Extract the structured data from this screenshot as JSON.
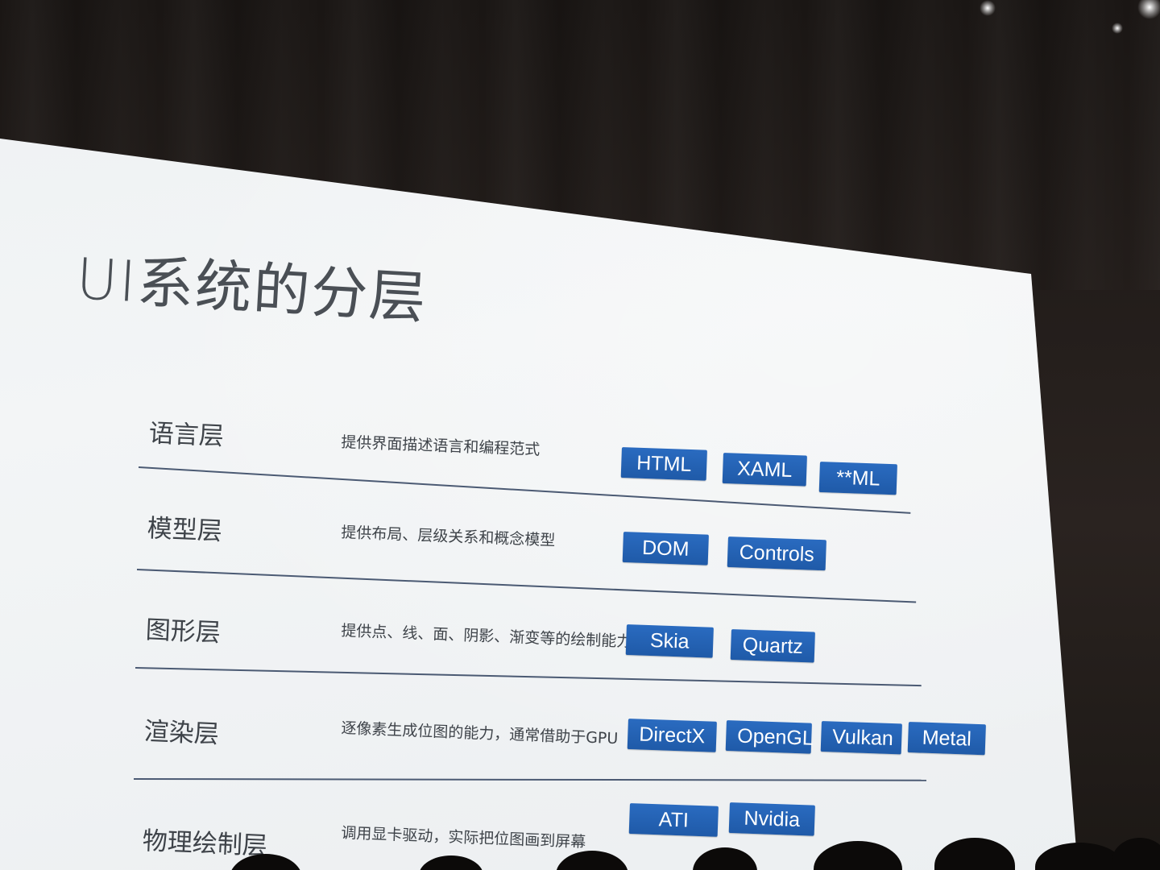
{
  "slide": {
    "title": "UI系统的分层",
    "accent_color": "#1f5aa8",
    "layers": [
      {
        "name": "语言层",
        "description": "提供界面描述语言和编程范式",
        "tags": [
          "HTML",
          "XAML",
          "**ML"
        ]
      },
      {
        "name": "模型层",
        "description": "提供布局、层级关系和概念模型",
        "tags": [
          "DOM",
          "Controls"
        ]
      },
      {
        "name": "图形层",
        "description": "提供点、线、面、阴影、渐变等的绘制能力",
        "tags": [
          "Skia",
          "Quartz"
        ]
      },
      {
        "name": "渲染层",
        "description": "逐像素生成位图的能力，通常借助于GPU",
        "tags": [
          "DirectX",
          "OpenGL",
          "Vulkan",
          "Metal"
        ]
      },
      {
        "name": "物理绘制层",
        "description": "调用显卡驱动，实际把位图画到屏幕",
        "tags": [
          "ATI",
          "Nvidia"
        ]
      }
    ]
  }
}
